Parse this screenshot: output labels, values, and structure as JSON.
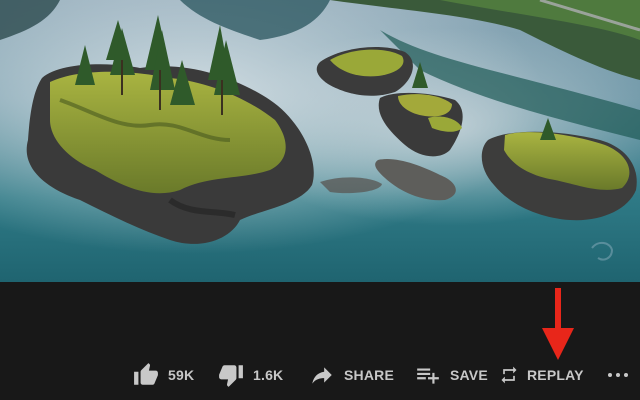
{
  "actions": {
    "like_count": "59K",
    "dislike_count": "1.6K",
    "share_label": "SHARE",
    "save_label": "SAVE",
    "replay_label": "REPLAY"
  },
  "icons": {
    "like": "thumb-up-icon",
    "dislike": "thumb-down-icon",
    "share": "share-arrow-icon",
    "save": "playlist-add-icon",
    "replay": "replay-loop-icon",
    "more": "more-horizontal-icon"
  },
  "colors": {
    "background": "#181818",
    "text": "#c8c8c8",
    "annotation_arrow": "#e8261a"
  }
}
